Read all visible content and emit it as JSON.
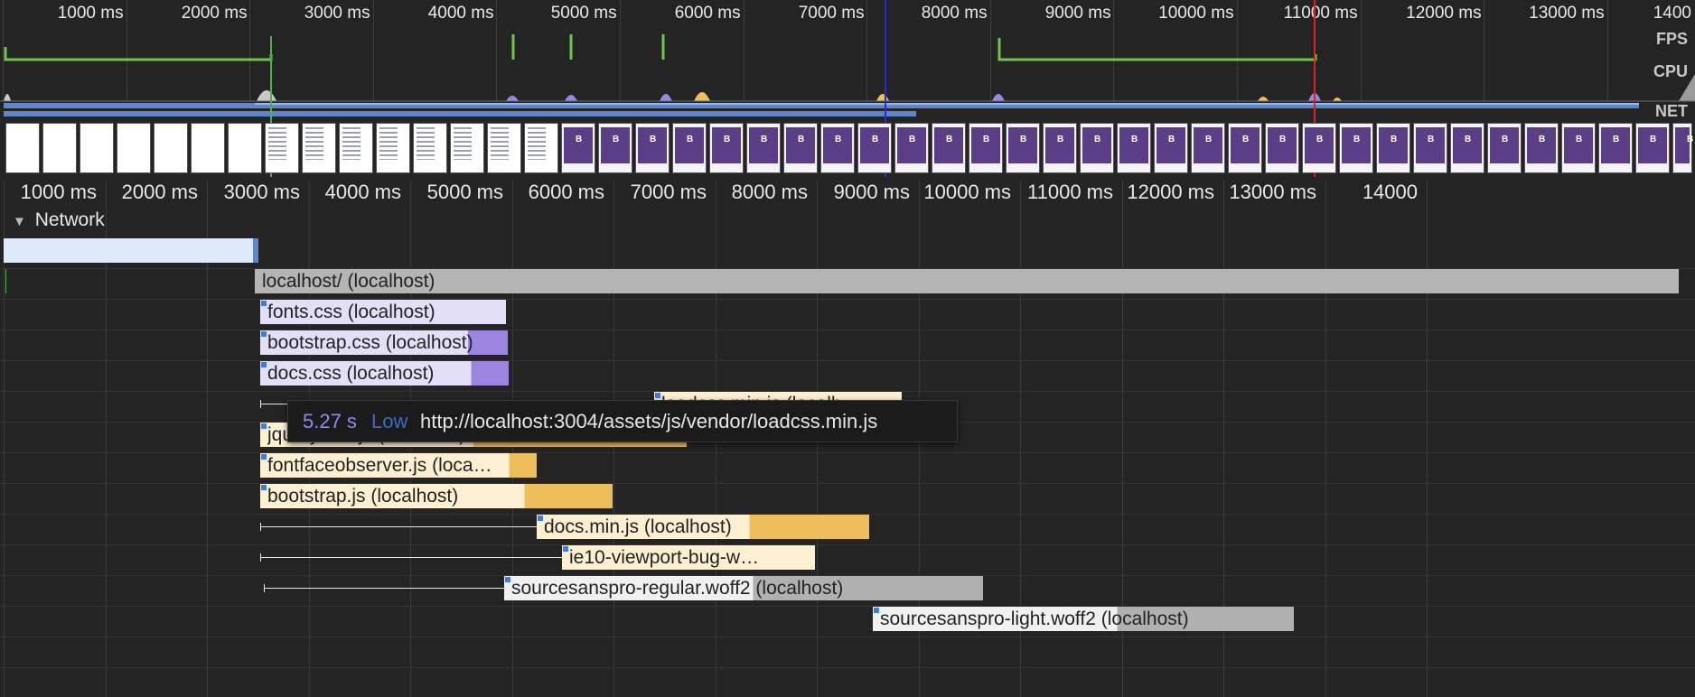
{
  "overview": {
    "ticks": [
      "1000 ms",
      "2000 ms",
      "3000 ms",
      "4000 ms",
      "5000 ms",
      "6000 ms",
      "7000 ms",
      "8000 ms",
      "9000 ms",
      "10000 ms",
      "11000 ms",
      "12000 ms",
      "13000 ms",
      "1400"
    ],
    "lanes": {
      "fps": "FPS",
      "cpu": "CPU",
      "net": "NET"
    }
  },
  "ruler": {
    "ticks": [
      "1000 ms",
      "2000 ms",
      "3000 ms",
      "4000 ms",
      "5000 ms",
      "6000 ms",
      "7000 ms",
      "8000 ms",
      "9000 ms",
      "10000 ms",
      "11000 ms",
      "12000 ms",
      "13000 ms",
      "14000"
    ]
  },
  "network": {
    "section_label": "Network",
    "requests": [
      {
        "label": "",
        "kind": "doc-pre"
      },
      {
        "label": "localhost/ (localhost)",
        "kind": "gray"
      },
      {
        "label": "fonts.css (localhost)",
        "kind": "css"
      },
      {
        "label": "bootstrap.css (localhost)",
        "kind": "css"
      },
      {
        "label": "docs.css (localhost)",
        "kind": "css"
      },
      {
        "label": "loadcss.min.js (localh…",
        "kind": "js"
      },
      {
        "label": "jquery.min.js (localhost)",
        "kind": "js"
      },
      {
        "label": "fontfaceobserver.js (loca…",
        "kind": "js"
      },
      {
        "label": "bootstrap.js (localhost)",
        "kind": "js"
      },
      {
        "label": "docs.min.js (localhost)",
        "kind": "js"
      },
      {
        "label": "ie10-viewport-bug-w…",
        "kind": "js"
      },
      {
        "label": "sourcesanspro-regular.woff2 (localhost)",
        "kind": "font"
      },
      {
        "label": "sourcesanspro-light.woff2 (localhost)",
        "kind": "font"
      }
    ],
    "tooltip": {
      "time": "5.27 s",
      "priority": "Low",
      "url": "http://localhost:3004/assets/js/vendor/loadcss.min.js"
    }
  },
  "colors": {
    "background": "#242424",
    "fps": "#6ec44f",
    "css_light": "#e3dff7",
    "css_dark": "#9b85e0",
    "js_light": "#fdf0d2",
    "js_dark": "#ecbf5a",
    "font_light": "#f0f0f0",
    "font_dark": "#b0b0b0",
    "gray": "#b4b4b4",
    "tooltip_time": "#8a8cf6",
    "tooltip_priority": "#3d6bbd",
    "marker_green": "#4caf50",
    "marker_blue": "#2a2ad0",
    "marker_red": "#e02020"
  }
}
